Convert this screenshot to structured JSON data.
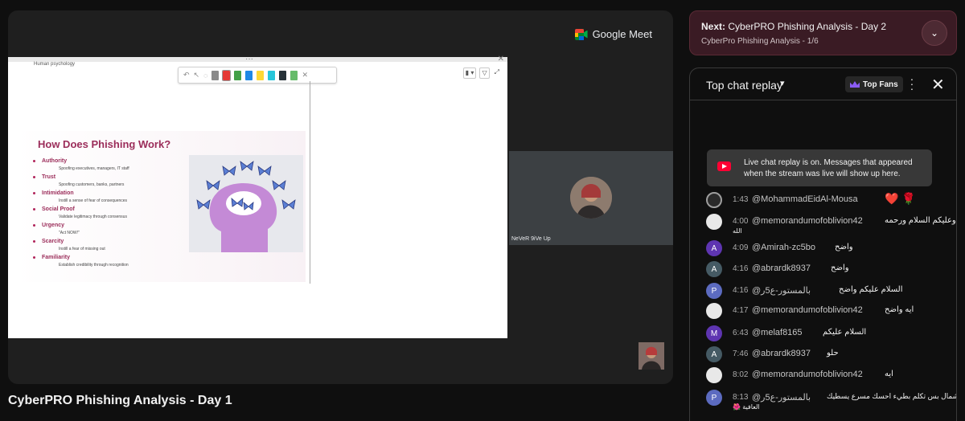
{
  "meet": {
    "logo_text": "Google Meet"
  },
  "slide": {
    "prev_text": "Human psychology",
    "title": "How Does Phishing Work?",
    "bullets": [
      {
        "head": "Authority",
        "sub": "Spoofing executives, managers, IT staff"
      },
      {
        "head": "Trust",
        "sub": "Spoofing customers, banks, partners"
      },
      {
        "head": "Intimidation",
        "sub": "Instill a sense of fear of consequences"
      },
      {
        "head": "Social Proof",
        "sub": "Validate legitimacy through consensus"
      },
      {
        "head": "Urgency",
        "sub": "\"Act NOW!\""
      },
      {
        "head": "Scarcity",
        "sub": "Instill a fear of missing out"
      },
      {
        "head": "Familiarity",
        "sub": "Establish credibility through recognition"
      }
    ]
  },
  "participant": {
    "name": "NeVeR 9iVe Up"
  },
  "video": {
    "title": "CyberPRO Phishing Analysis - Day 1"
  },
  "next_up": {
    "label": "Next:",
    "title": "CyberPRO Phishing Analysis - Day 2",
    "subtitle": "CyberPro Phishing Analysis - 1/6"
  },
  "chat": {
    "title": "Top chat replay",
    "top_fans": "Top Fans",
    "notice": "Live chat replay is on. Messages that appeared when the stream was live will show up here.",
    "messages": [
      {
        "time": "1:43",
        "user": "@MohammadEidAl-Mousa",
        "text": "❤️ 🌹",
        "avatar": "",
        "color": "#2a2a2a"
      },
      {
        "time": "4:00",
        "user": "@memorandumofoblivion42",
        "text": "وعليكم السلام ورحمه",
        "text2": "الله",
        "avatar": "",
        "color": "#e8e8e8"
      },
      {
        "time": "4:09",
        "user": "@Amirah-zc5bo",
        "text": "واضح",
        "avatar": "A",
        "color": "#5e35b1"
      },
      {
        "time": "4:16",
        "user": "@abrardk8937",
        "text": "واضح",
        "avatar": "A",
        "color": "#455a64"
      },
      {
        "time": "4:16",
        "user": "@بالمستور-ع5ر",
        "text": "السلام عليكم واضح",
        "avatar": "P",
        "color": "#5c6bc0"
      },
      {
        "time": "4:17",
        "user": "@memorandumofoblivion42",
        "text": "ايه واضح",
        "avatar": "",
        "color": "#e8e8e8"
      },
      {
        "time": "6:43",
        "user": "@melaf8165",
        "text": "السلام عليكم",
        "avatar": "M",
        "color": "#5e35b1"
      },
      {
        "time": "7:46",
        "user": "@abrardk8937",
        "text": "حلو",
        "avatar": "A",
        "color": "#455a64"
      },
      {
        "time": "8:02",
        "user": "@memorandumofoblivion42",
        "text": "ايه",
        "avatar": "",
        "color": "#e8e8e8"
      },
      {
        "time": "8:13",
        "user": "@بالمستور-ع5ر",
        "text": "شمال بس تكلم بطيء احسك مسرع يسطيك",
        "text2": "🌺 العافية",
        "avatar": "P",
        "color": "#5c6bc0"
      }
    ]
  }
}
